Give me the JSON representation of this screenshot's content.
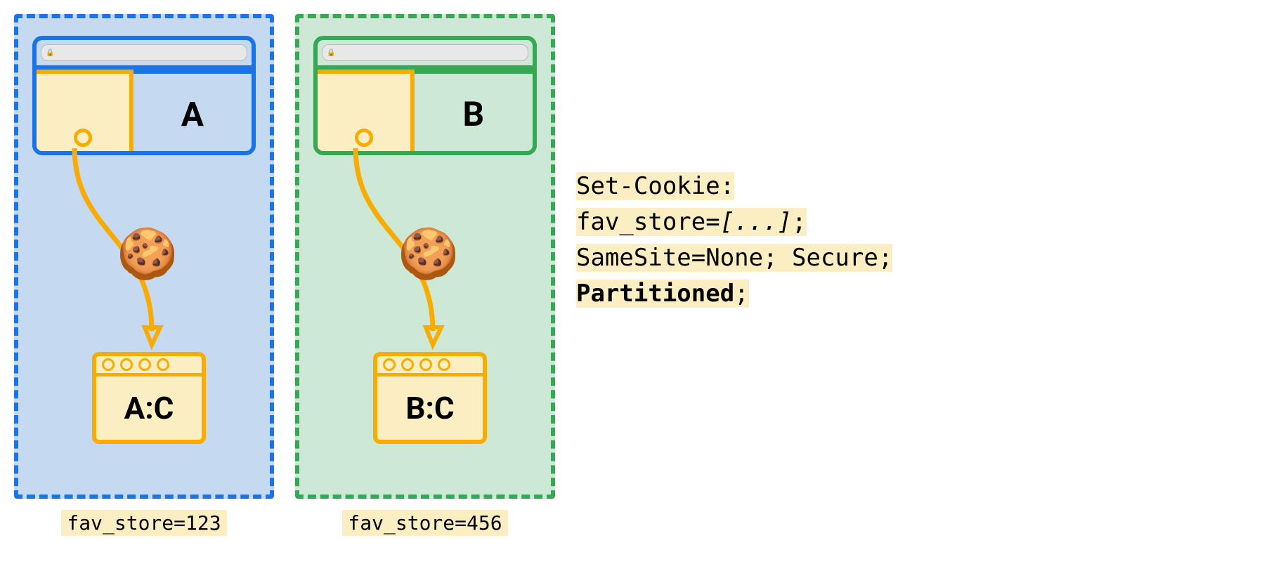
{
  "partitions": [
    {
      "browser_label": "A",
      "jar_label": "A:C",
      "cookie_value": "fav_store=123",
      "color": "blue"
    },
    {
      "browser_label": "B",
      "jar_label": "B:C",
      "cookie_value": "fav_store=456",
      "color": "green"
    }
  ],
  "code": {
    "line1": "Set-Cookie:",
    "line2a": "fav_store=",
    "line2b": "[...]",
    "line2c": ";",
    "line3": "SameSite=None; Secure;",
    "line4a": "Partitioned",
    "line4b": ";"
  },
  "icons": {
    "cookie_emoji": "🍪",
    "lock": "🔒"
  }
}
